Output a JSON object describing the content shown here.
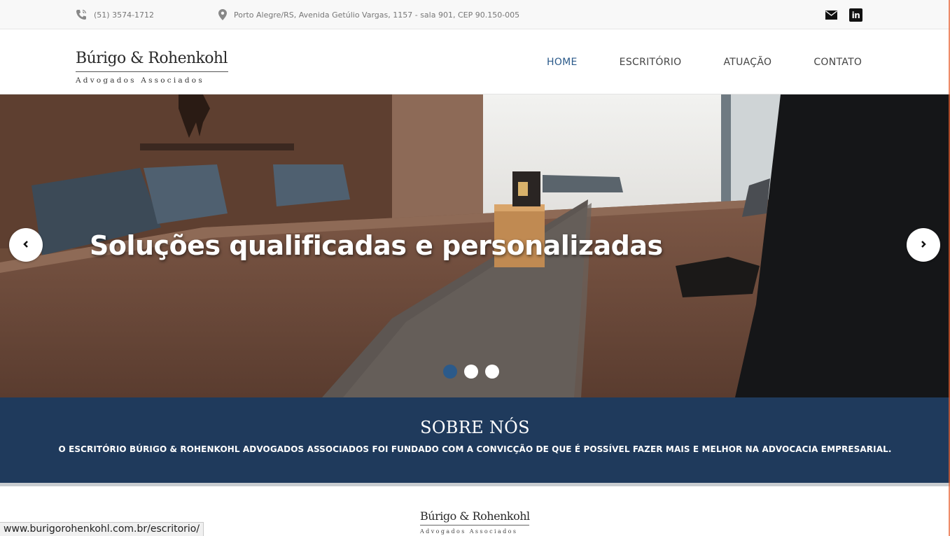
{
  "topbar": {
    "phone": "(51) 3574-1712",
    "address": "Porto Alegre/RS, Avenida Getúlio Vargas, 1157 - sala 901, CEP 90.150-005",
    "icons": [
      "phone-icon",
      "map-pin-icon",
      "mail-icon",
      "linkedin-icon"
    ],
    "linkedin_glyph": "in"
  },
  "header": {
    "logo_name": "Búrigo & Rohenkohl",
    "logo_sub": "Advogados Associados",
    "nav": [
      {
        "label": "HOME",
        "active": true
      },
      {
        "label": "ESCRITÓRIO",
        "active": false
      },
      {
        "label": "ATUAÇÃO",
        "active": false
      },
      {
        "label": "CONTATO",
        "active": false
      }
    ]
  },
  "hero": {
    "headline": "Soluções qualificadas e personalizadas",
    "slide_count": 3,
    "active_slide": 1
  },
  "about": {
    "title": "SOBRE NÓS",
    "text": "O ESCRITÓRIO BÚRIGO & ROHENKOHL ADVOGADOS ASSOCIADOS FOI FUNDADO COM A CONVICÇÃO DE QUE É POSSÍVEL FAZER MAIS E MELHOR NA ADVOCACIA EMPRESARIAL."
  },
  "footer": {
    "logo_name": "Búrigo & Rohenkohl",
    "logo_sub": "Advogados Associados"
  },
  "statusbar": {
    "url": "www.burigorohenkohl.com.br/escritorio/"
  },
  "colors": {
    "accent": "#2b5a8a",
    "band": "#1f3a5c"
  }
}
